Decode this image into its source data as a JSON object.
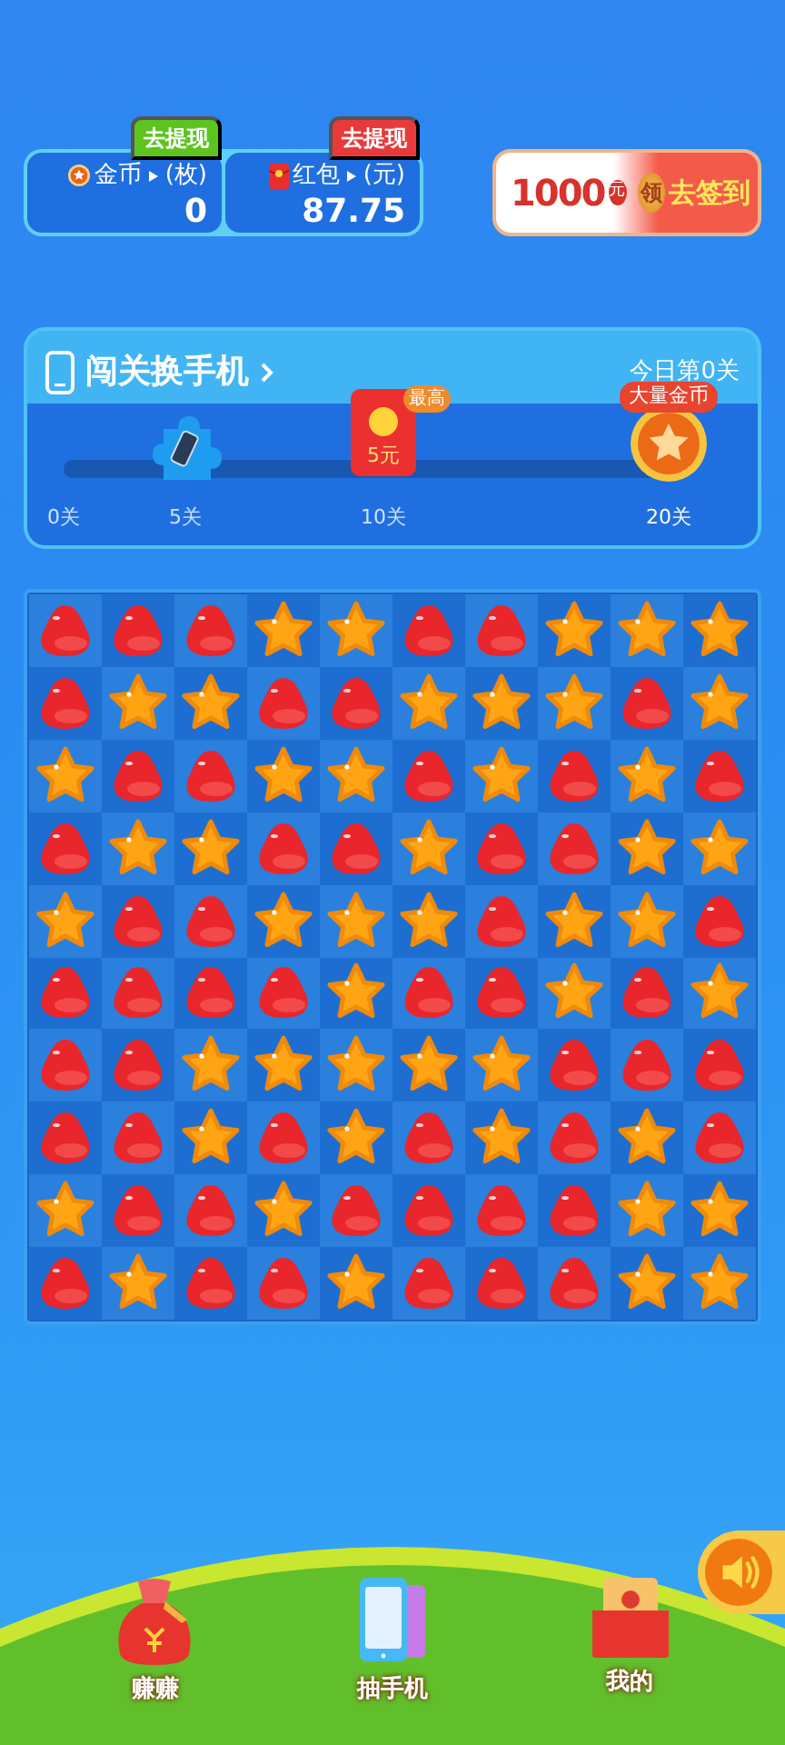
{
  "wallet": [
    {
      "kind": "coin",
      "withdraw": "去提现",
      "label": "金币",
      "unit": "(枚)",
      "value": "0"
    },
    {
      "kind": "redpacket",
      "withdraw": "去提现",
      "label": "红包",
      "unit": "(元)",
      "value": "87.75"
    }
  ],
  "signin": {
    "amount": "1000",
    "currency": "元",
    "badge": "领",
    "action": "去签到"
  },
  "challenge": {
    "title": "闯关换手机",
    "today": "今日第0关",
    "level": 0,
    "milestones": [
      {
        "label": "0关",
        "kind": "none"
      },
      {
        "label": "5关",
        "kind": "phone"
      },
      {
        "label": "10关",
        "kind": "redpacket",
        "amount": "5元",
        "tag": "最高"
      },
      {
        "label": "20关",
        "kind": "coin",
        "tag": "大量金币"
      }
    ]
  },
  "board": [
    [
      {
        "kind": "drop"
      },
      {
        "kind": "drop"
      },
      {
        "kind": "drop"
      },
      {
        "kind": "star"
      },
      {
        "kind": "star"
      },
      {
        "kind": "drop"
      },
      {
        "kind": "drop"
      },
      {
        "kind": "star"
      },
      {
        "kind": "star"
      },
      {
        "kind": "star"
      }
    ],
    [
      {
        "kind": "drop"
      },
      {
        "kind": "star"
      },
      {
        "kind": "star"
      },
      {
        "kind": "drop"
      },
      {
        "kind": "drop"
      },
      {
        "kind": "star"
      },
      {
        "kind": "star"
      },
      {
        "kind": "star"
      },
      {
        "kind": "drop"
      },
      {
        "kind": "star"
      }
    ],
    [
      {
        "kind": "star"
      },
      {
        "kind": "drop"
      },
      {
        "kind": "drop"
      },
      {
        "kind": "star"
      },
      {
        "kind": "star"
      },
      {
        "kind": "drop"
      },
      {
        "kind": "star"
      },
      {
        "kind": "drop"
      },
      {
        "kind": "star"
      },
      {
        "kind": "drop"
      }
    ],
    [
      {
        "kind": "drop"
      },
      {
        "kind": "star"
      },
      {
        "kind": "star"
      },
      {
        "kind": "drop"
      },
      {
        "kind": "drop"
      },
      {
        "kind": "star"
      },
      {
        "kind": "drop"
      },
      {
        "kind": "drop"
      },
      {
        "kind": "star"
      },
      {
        "kind": "star"
      }
    ],
    [
      {
        "kind": "star"
      },
      {
        "kind": "drop"
      },
      {
        "kind": "drop"
      },
      {
        "kind": "star"
      },
      {
        "kind": "star"
      },
      {
        "kind": "star"
      },
      {
        "kind": "drop"
      },
      {
        "kind": "star"
      },
      {
        "kind": "star"
      },
      {
        "kind": "drop"
      }
    ],
    [
      {
        "kind": "drop"
      },
      {
        "kind": "drop"
      },
      {
        "kind": "drop"
      },
      {
        "kind": "drop"
      },
      {
        "kind": "star"
      },
      {
        "kind": "drop"
      },
      {
        "kind": "drop"
      },
      {
        "kind": "star"
      },
      {
        "kind": "drop"
      },
      {
        "kind": "star"
      }
    ],
    [
      {
        "kind": "drop"
      },
      {
        "kind": "drop"
      },
      {
        "kind": "star"
      },
      {
        "kind": "star"
      },
      {
        "kind": "star"
      },
      {
        "kind": "star"
      },
      {
        "kind": "star"
      },
      {
        "kind": "drop"
      },
      {
        "kind": "drop"
      },
      {
        "kind": "drop"
      }
    ],
    [
      {
        "kind": "drop"
      },
      {
        "kind": "drop"
      },
      {
        "kind": "star"
      },
      {
        "kind": "drop"
      },
      {
        "kind": "star"
      },
      {
        "kind": "drop"
      },
      {
        "kind": "star"
      },
      {
        "kind": "drop"
      },
      {
        "kind": "star"
      },
      {
        "kind": "drop"
      }
    ],
    [
      {
        "kind": "star"
      },
      {
        "kind": "drop"
      },
      {
        "kind": "drop"
      },
      {
        "kind": "star"
      },
      {
        "kind": "drop"
      },
      {
        "kind": "drop"
      },
      {
        "kind": "drop"
      },
      {
        "kind": "drop"
      },
      {
        "kind": "star"
      },
      {
        "kind": "star"
      }
    ],
    [
      {
        "kind": "drop"
      },
      {
        "kind": "star"
      },
      {
        "kind": "drop"
      },
      {
        "kind": "drop"
      },
      {
        "kind": "star"
      },
      {
        "kind": "drop"
      },
      {
        "kind": "drop"
      },
      {
        "kind": "drop"
      },
      {
        "kind": "star"
      },
      {
        "kind": "star"
      }
    ]
  ],
  "nav": [
    {
      "label": "赚赚",
      "kind": "bag"
    },
    {
      "label": "抽手机",
      "kind": "phone"
    },
    {
      "label": "我的",
      "kind": "profile"
    }
  ]
}
